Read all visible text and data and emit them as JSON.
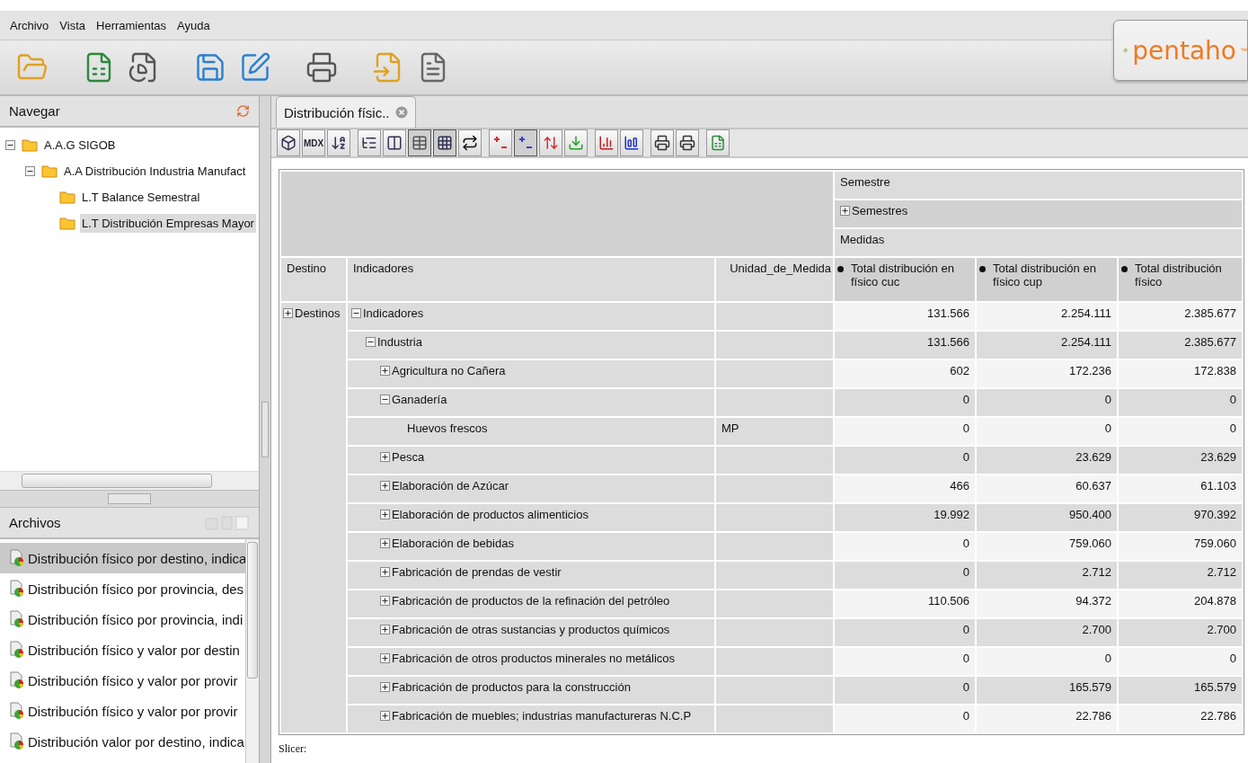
{
  "menu": [
    "Archivo",
    "Vista",
    "Herramientas",
    "Ayuda"
  ],
  "toolbar_groups": [
    {
      "buttons": [
        {
          "kind": "open"
        }
      ]
    },
    {
      "buttons": [
        {
          "kind": "new-report"
        },
        {
          "kind": "new-analysis"
        }
      ]
    },
    {
      "buttons": [
        {
          "kind": "save"
        },
        {
          "kind": "save-as"
        }
      ]
    },
    {
      "buttons": [
        {
          "kind": "print"
        }
      ]
    },
    {
      "buttons": [
        {
          "kind": "import"
        },
        {
          "kind": "properties"
        }
      ]
    }
  ],
  "logo": {
    "text": "pentaho",
    "mark": "™"
  },
  "navigator": {
    "title": "Navegar",
    "tree": [
      {
        "label": "A.A.G SIGOB",
        "expanded": true,
        "selected": false,
        "children": [
          {
            "label": "A.A Distribución Industria Manufact",
            "expanded": true,
            "selected": false,
            "children": [
              {
                "label": "L.T Balance Semestral",
                "selected": false
              },
              {
                "label": "L.T Distribución Empresas Mayor",
                "selected": true
              }
            ]
          }
        ]
      }
    ]
  },
  "files": {
    "title": "Archivos",
    "items": [
      {
        "label": "Distribución físico por destino, indica",
        "selected": true
      },
      {
        "label": "Distribución físico por provincia, des",
        "selected": false
      },
      {
        "label": "Distribución físico por provincia, indi",
        "selected": false
      },
      {
        "label": "Distribución físico y valor por destin",
        "selected": false
      },
      {
        "label": "Distribución físico y valor por provir",
        "selected": false
      },
      {
        "label": "Distribución físico y valor por provir",
        "selected": false
      },
      {
        "label": "Distribución valor por destino, indica",
        "selected": false
      }
    ]
  },
  "tabs": [
    {
      "label": "Distribución físic..",
      "selected": true
    }
  ],
  "pivot_toolbar_groups": [
    {
      "buttons": [
        {
          "kind": "cube",
          "pressed": false
        },
        {
          "kind": "mdx",
          "label": "MDX",
          "pressed": false
        },
        {
          "kind": "sort",
          "pressed": false
        }
      ]
    },
    {
      "buttons": [
        {
          "kind": "hierarchy",
          "pressed": false
        },
        {
          "kind": "parents",
          "pressed": false
        },
        {
          "kind": "table",
          "pressed": true
        },
        {
          "kind": "hide-empty",
          "pressed": true
        },
        {
          "kind": "swap",
          "pressed": false
        }
      ]
    },
    {
      "buttons": [
        {
          "kind": "drill-member",
          "pressed": false
        },
        {
          "kind": "drill-position",
          "pressed": true
        },
        {
          "kind": "drill-replace",
          "pressed": false
        },
        {
          "kind": "drill-through",
          "pressed": false
        }
      ]
    },
    {
      "buttons": [
        {
          "kind": "chart",
          "pressed": false
        },
        {
          "kind": "chart-config",
          "pressed": false
        }
      ]
    },
    {
      "buttons": [
        {
          "kind": "print-setup",
          "pressed": false
        },
        {
          "kind": "print",
          "pressed": false
        }
      ]
    },
    {
      "buttons": [
        {
          "kind": "excel",
          "pressed": false
        }
      ]
    }
  ],
  "pivot": {
    "column_dimension": "Semestre",
    "column_member": {
      "label": "Semestres",
      "expanded": false
    },
    "measures_label": "Medidas",
    "row_headers": [
      "Destino",
      "Indicadores",
      "Unidad_de_Medida"
    ],
    "measures": [
      "Total distribución en físico cuc",
      "Total distribución en físico cup",
      "Total distribución físico"
    ],
    "destination": {
      "label": "Destinos",
      "expanded": false
    },
    "rows": [
      {
        "label": "Indicadores",
        "expanded": true,
        "values": [
          "131.566",
          "2.254.111",
          "2.385.677"
        ],
        "children": [
          {
            "label": "Industria",
            "expanded": true,
            "values": [
              "131.566",
              "2.254.111",
              "2.385.677"
            ],
            "children": [
              {
                "label": "Agricultura no Cañera",
                "expanded": false,
                "values": [
                  "602",
                  "172.236",
                  "172.838"
                ]
              },
              {
                "label": "Ganadería",
                "expanded": true,
                "values": [
                  "0",
                  "0",
                  "0"
                ],
                "children": [
                  {
                    "label": "Huevos frescos",
                    "unit": "MP",
                    "values": [
                      "0",
                      "0",
                      "0"
                    ]
                  }
                ]
              },
              {
                "label": "Pesca",
                "expanded": false,
                "values": [
                  "0",
                  "23.629",
                  "23.629"
                ]
              },
              {
                "label": "Elaboración de Azúcar",
                "expanded": false,
                "values": [
                  "466",
                  "60.637",
                  "61.103"
                ]
              },
              {
                "label": "Elaboración de productos alimenticios",
                "expanded": false,
                "values": [
                  "19.992",
                  "950.400",
                  "970.392"
                ]
              },
              {
                "label": "Elaboración de bebidas",
                "expanded": false,
                "values": [
                  "0",
                  "759.060",
                  "759.060"
                ]
              },
              {
                "label": "Fabricación de prendas de vestir",
                "expanded": false,
                "values": [
                  "0",
                  "2.712",
                  "2.712"
                ]
              },
              {
                "label": "Fabricación de productos de la refinación del petróleo",
                "expanded": false,
                "values": [
                  "110.506",
                  "94.372",
                  "204.878"
                ]
              },
              {
                "label": "Fabricación de otras sustancias y productos químicos",
                "expanded": false,
                "values": [
                  "0",
                  "2.700",
                  "2.700"
                ]
              },
              {
                "label": "Fabricación de otros productos minerales no metálicos",
                "expanded": false,
                "values": [
                  "0",
                  "0",
                  "0"
                ]
              },
              {
                "label": "Fabricación de productos para la construcción",
                "expanded": false,
                "values": [
                  "0",
                  "165.579",
                  "165.579"
                ]
              },
              {
                "label": "Fabricación de muebles; industrias manufactureras N.C.P",
                "expanded": false,
                "values": [
                  "0",
                  "22.786",
                  "22.786"
                ]
              }
            ]
          }
        ]
      }
    ]
  },
  "slicer": "Slicer:"
}
